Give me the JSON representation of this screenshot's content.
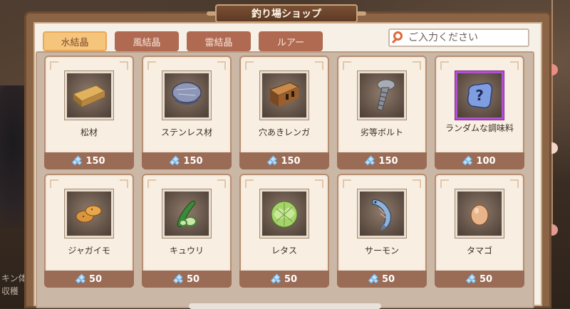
{
  "title": "釣り場ショップ",
  "tabs": [
    {
      "label": "水結晶",
      "active": true
    },
    {
      "label": "風結晶",
      "active": false
    },
    {
      "label": "雷結晶",
      "active": false
    },
    {
      "label": "ルアー",
      "active": false
    }
  ],
  "search": {
    "placeholder": "ご入力ください",
    "value": ""
  },
  "currency_icon": "water-crystal-icon",
  "items": [
    {
      "name": "松材",
      "price": "150",
      "icon": "pine-wood-icon"
    },
    {
      "name": "ステンレス材",
      "price": "150",
      "icon": "stainless-material-icon"
    },
    {
      "name": "穴あきレンガ",
      "price": "150",
      "icon": "perforated-brick-icon"
    },
    {
      "name": "劣等ボルト",
      "price": "150",
      "icon": "inferior-bolt-icon"
    },
    {
      "name": "ランダムな調味料",
      "price": "100",
      "icon": "random-seasoning-icon",
      "rare": true
    },
    {
      "name": "ジャガイモ",
      "price": "50",
      "icon": "potato-icon"
    },
    {
      "name": "キュウリ",
      "price": "50",
      "icon": "cucumber-icon"
    },
    {
      "name": "レタス",
      "price": "50",
      "icon": "lettuce-icon"
    },
    {
      "name": "サーモン",
      "price": "50",
      "icon": "salmon-icon"
    },
    {
      "name": "タマゴ",
      "price": "50",
      "icon": "egg-icon"
    }
  ],
  "background_text": [
    "キン体",
    "収穫"
  ],
  "colors": {
    "active_tab": "#f6c57c",
    "inactive_tab": "#b06a52",
    "price_bar": "#9a6b55",
    "rare_border": "#b64fd0"
  }
}
